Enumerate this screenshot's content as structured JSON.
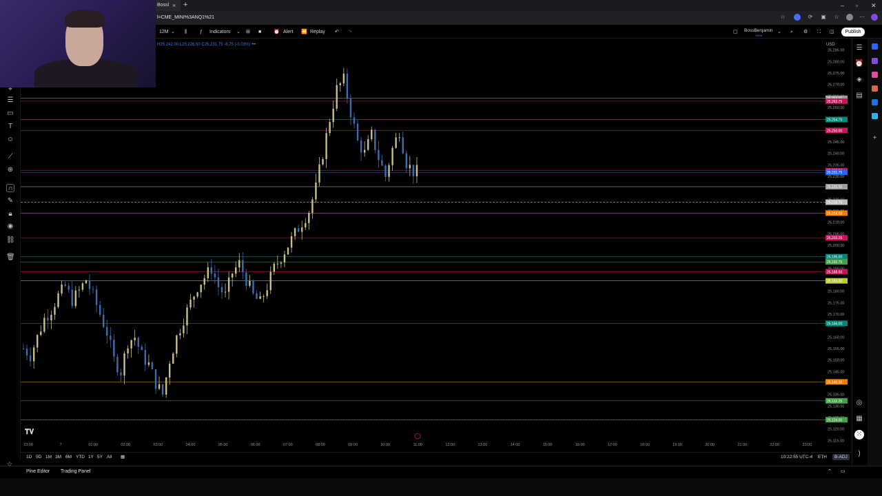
{
  "browser": {
    "tab_title": "Bossl",
    "url": "l=CME_MINI%3ANQ1%21"
  },
  "toolbar": {
    "interval": "12M",
    "indicators_label": "Indicators",
    "alert_label": "Alert",
    "replay_label": "Replay",
    "username": "BossBenjamin",
    "user_status": "Save",
    "publish_label": "Publish"
  },
  "legend": {
    "ohlc": "H25,242.00 L25,226.50 C25,231.75 -8.75 (-0.03%)"
  },
  "chart_data": {
    "type": "candlestick",
    "currency": "USD",
    "x_ticks": [
      "23:00",
      "7",
      "01:00",
      "02:00",
      "03:00",
      "04:00",
      "05:00",
      "06:00",
      "07:00",
      "08:00",
      "09:00",
      "10:00",
      "11:00",
      "12:00",
      "13:00",
      "14:00",
      "15:00",
      "16:00",
      "17:00",
      "18:00",
      "19:00",
      "20:00",
      "21:00",
      "22:00",
      "23:00"
    ],
    "y_ticks": [
      25285,
      25280,
      25275,
      25270,
      25265,
      25260,
      25255,
      25250,
      25245,
      25240,
      25235,
      25230,
      25225,
      25220,
      25215,
      25210,
      25205,
      25200,
      25195,
      25190,
      25185,
      25180,
      25175,
      25170,
      25165,
      25160,
      25155,
      25150,
      25145,
      25140,
      25135,
      25130,
      25125,
      25120,
      25115
    ],
    "ylim": [
      25113,
      25290
    ],
    "horizontal_levels": [
      {
        "price": 25264.0,
        "label": "25,264.00",
        "color": "#9e9e9e"
      },
      {
        "price": 25262.75,
        "label": "25,262.75",
        "color": "#c2185b"
      },
      {
        "price": 25254.75,
        "label": "25,254.75",
        "color": "#00897b"
      },
      {
        "price": 25250.0,
        "label": "25,250.00",
        "color": "#c2185b"
      },
      {
        "price": 25232.5,
        "label": "25,232.50",
        "color": "#c2185b"
      },
      {
        "price": 25231.75,
        "label": "25,231.75",
        "color": "#2962ff"
      },
      {
        "price": 25225.5,
        "label": "25,225.50",
        "color": "#9e9e9e"
      },
      {
        "price": 25218.75,
        "label": "25,218.75",
        "color": "#bdbdbd"
      },
      {
        "price": 25214.0,
        "label": "25,214.00",
        "color": "#f57c00"
      },
      {
        "price": 25203.25,
        "label": "25,203.25",
        "color": "#c2185b"
      },
      {
        "price": 25195.0,
        "label": "25,195.00",
        "color": "#00897b"
      },
      {
        "price": 25192.75,
        "label": "25,192.75",
        "color": "#43a047"
      },
      {
        "price": 25188.5,
        "label": "25,188.50",
        "color": "#c2185b"
      },
      {
        "price": 25184.5,
        "label": "25,184.50",
        "color": "#c0ca33"
      },
      {
        "price": 25166.0,
        "label": "25,166.00",
        "color": "#00897b"
      },
      {
        "price": 25140.5,
        "label": "25,140.50",
        "color": "#f57c00"
      },
      {
        "price": 25132.25,
        "label": "25,132.25",
        "color": "#43a047"
      },
      {
        "price": 25124.0,
        "label": "25,124.00",
        "color": "#43a047"
      }
    ],
    "candles_close_path": [
      25155,
      25152,
      25160,
      25168,
      25172,
      25178,
      25182,
      25176,
      25180,
      25185,
      25178,
      25170,
      25162,
      25150,
      25145,
      25158,
      25160,
      25152,
      25148,
      25140,
      25135,
      25150,
      25160,
      25168,
      25175,
      25182,
      25186,
      25190,
      25182,
      25178,
      25188,
      25192,
      25185,
      25178,
      25175,
      25182,
      25190,
      25195,
      25200,
      25205,
      25210,
      25215,
      25225,
      25240,
      25255,
      25268,
      25272,
      25258,
      25245,
      25240,
      25248,
      25238,
      25230,
      25242,
      25250,
      25236,
      25232
    ]
  },
  "bottom": {
    "ranges": [
      "1D",
      "5D",
      "1M",
      "3M",
      "6M",
      "YTD",
      "1Y",
      "5Y",
      "All"
    ],
    "clock": "10:22:55 UTC-4",
    "session": "ETH",
    "badge": "B-ADJ",
    "pine_editor": "Pine Editor",
    "trading_panel": "Trading Panel"
  }
}
